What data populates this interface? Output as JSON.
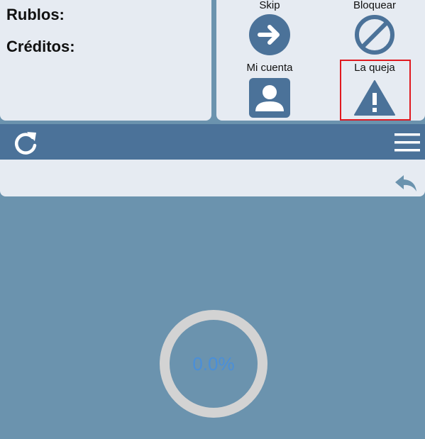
{
  "stats": {
    "rublos_label": "Rublos:",
    "creditos_label": "Créditos:"
  },
  "actions": {
    "skip_label": "Skip",
    "block_label": "Bloquear",
    "account_label": "Mi cuenta",
    "report_label": "La queja"
  },
  "icons": {
    "skip": "arrow-right-circle-icon",
    "block": "prohibited-icon",
    "account": "user-icon",
    "report": "warning-triangle-icon",
    "refresh": "refresh-icon",
    "menu": "hamburger-menu-icon",
    "back": "reply-arrow-icon"
  },
  "progress": {
    "text": "0.0%",
    "value": 0.0
  },
  "colors": {
    "accent": "#4b7299",
    "highlight": "#e0191f",
    "progress_text": "#4a8fd9",
    "ring": "#d3d3d3",
    "background": "#6b93ae",
    "panel": "#e6ebf2"
  }
}
